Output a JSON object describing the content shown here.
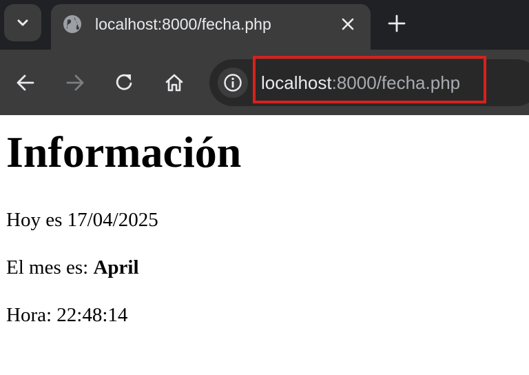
{
  "browser": {
    "tab": {
      "title": "localhost:8000/fecha.php"
    },
    "address_bar": {
      "host": "localhost",
      "rest": ":8000/fecha.php"
    },
    "icons": [
      "tab-search-icon",
      "globe-icon",
      "close-icon",
      "plus-icon",
      "back-icon",
      "forward-icon",
      "reload-icon",
      "home-icon",
      "info-icon"
    ],
    "highlight_color": "#d9201c"
  },
  "page": {
    "heading": "Información",
    "date_prefix": "Hoy es ",
    "date_value": "17/04/2025",
    "month_prefix": "El mes es: ",
    "month_value": "April",
    "time_prefix": "Hora: ",
    "time_value": "22:48:14"
  }
}
